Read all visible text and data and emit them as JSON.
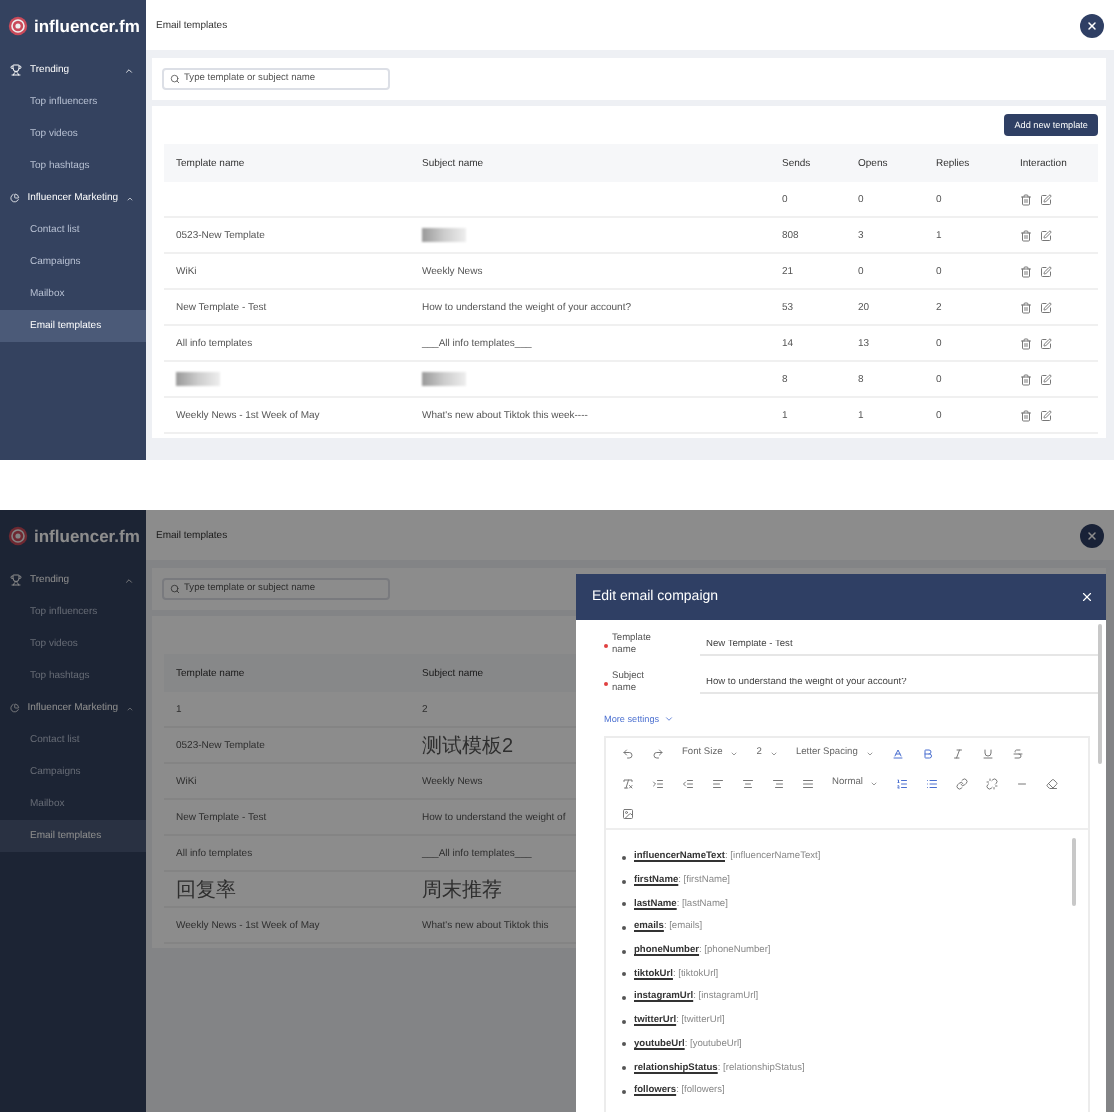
{
  "top_screen": {
    "logo": "influencer.fm",
    "header_title": "Email templates",
    "sidebar": [
      {
        "label": "Trending",
        "expanded": true,
        "children": [
          {
            "label": "Top influencers",
            "selected": false
          },
          {
            "label": "Top videos",
            "selected": false
          },
          {
            "label": "Top hashtags",
            "selected": false
          }
        ]
      },
      {
        "label": "Influencer Marketing",
        "expanded": true,
        "children": [
          {
            "label": "Contact list",
            "selected": false
          },
          {
            "label": "Campaigns",
            "selected": false
          },
          {
            "label": "Mailbox",
            "selected": false
          },
          {
            "label": "Email templates",
            "selected": true
          }
        ]
      }
    ],
    "search_placeholder": "Type template or subject name",
    "add_button": "Add new template",
    "columns": [
      "Template name",
      "Subject name",
      "Sends",
      "Opens",
      "Replies",
      "Interaction"
    ],
    "rows": [
      [
        null,
        null,
        "0",
        "0",
        "0"
      ],
      [
        "0523-New Template",
        {
          "kind": "blurred"
        },
        "808",
        "3",
        "1"
      ],
      [
        "WiKi",
        "Weekly News",
        "21",
        "0",
        "0"
      ],
      [
        "New Template - Test",
        "How to understand the weight of your account?",
        "53",
        "20",
        "2"
      ],
      [
        "All info templates",
        "___All info templates___",
        "14",
        "13",
        "0"
      ],
      [
        {
          "kind": "blurred"
        },
        {
          "kind": "blurred"
        },
        "8",
        "8",
        "0"
      ],
      [
        "Weekly News - 1st Week of May",
        "What's new about Tiktok this week----",
        "1",
        "1",
        "0"
      ]
    ]
  },
  "bottom_screen": {
    "logo": "influencer.fm",
    "header_title": "Email templates",
    "sidebar": [
      {
        "label": "Trending",
        "expanded": true,
        "children": [
          {
            "label": "Top influencers",
            "selected": false
          },
          {
            "label": "Top videos",
            "selected": false
          },
          {
            "label": "Top hashtags",
            "selected": false
          }
        ]
      },
      {
        "label": "Influencer Marketing",
        "expanded": true,
        "children": [
          {
            "label": "Contact list",
            "selected": false
          },
          {
            "label": "Campaigns",
            "selected": false
          },
          {
            "label": "Mailbox",
            "selected": false
          },
          {
            "label": "Email templates",
            "selected": true
          }
        ]
      }
    ],
    "search_placeholder": "Type template or subject name",
    "columns": [
      "Template name",
      "Subject name"
    ],
    "rows": [
      [
        "1",
        "2"
      ],
      [
        "0523-New Template",
        "测试模板2"
      ],
      [
        "WiKi",
        "Weekly News"
      ],
      [
        "New Template - Test",
        "How to understand the weight of"
      ],
      [
        "All info templates",
        "___All info templates___"
      ],
      [
        "回复率",
        "周末推荐"
      ],
      [
        "Weekly News - 1st Week of May",
        "What's new about Tiktok this"
      ]
    ],
    "dialog": {
      "title": "Edit email compaign",
      "fields": [
        {
          "label": "Template name",
          "required": true,
          "value": "New Template - Test"
        },
        {
          "label": "Subject name",
          "required": true,
          "value": "How to understand the weight of your account?"
        }
      ],
      "more_settings": "More settings",
      "toolbar": [
        [
          {
            "kind": "undo"
          },
          {
            "kind": "redo"
          },
          {
            "kind": "select",
            "label": "Font Size"
          },
          {
            "kind": "select",
            "label": "2"
          },
          {
            "kind": "select",
            "label": "Letter Spacing"
          },
          {
            "kind": "font-color"
          },
          {
            "kind": "bold"
          },
          {
            "kind": "italic"
          },
          {
            "kind": "underline"
          },
          {
            "kind": "strikethrough"
          }
        ],
        [
          {
            "kind": "clear-format"
          },
          {
            "kind": "indent"
          },
          {
            "kind": "outdent"
          },
          {
            "kind": "align-left"
          },
          {
            "kind": "align-center"
          },
          {
            "kind": "align-right"
          },
          {
            "kind": "justify"
          },
          {
            "kind": "select",
            "label": "Normal"
          },
          {
            "kind": "ordered-list"
          },
          {
            "kind": "bullet-list"
          },
          {
            "kind": "link"
          },
          {
            "kind": "unlink"
          },
          {
            "kind": "rule"
          },
          {
            "kind": "eraser"
          }
        ],
        [
          {
            "kind": "image"
          }
        ]
      ],
      "variables": [
        "**influencerNameText**: [influencerNameText]",
        "**firstName**: [firstName]",
        "**lastName**: [lastName]",
        "**emails**: [emails]",
        "**phoneNumber**: [phoneNumber]",
        "**tiktokUrl**: [tiktokUrl]",
        "**instagramUrl**: [instagramUrl]",
        "**twitterUrl**: [twitterUrl]",
        "**youtubeUrl**: [youtubeUrl]",
        "**relationshipStatus**: [relationshipStatus]",
        "**followers**: [followers]"
      ]
    }
  }
}
